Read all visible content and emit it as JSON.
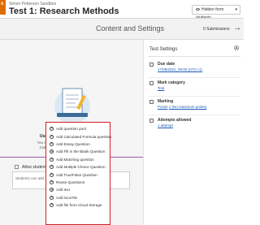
{
  "header": {
    "course_name": "Simon Petterson Sandbox",
    "title": "Test 1: Research Methods",
    "visibility": "Hidden from students",
    "close_glyph": "x"
  },
  "content_bar": {
    "title": "Content and Settings",
    "submissions": "0 Submissions"
  },
  "builder": {
    "title": "Use this space to build your test.",
    "subtitle_1": "You can save your changes along the way.",
    "subtitle_2": "Just close the test when you're finished."
  },
  "allow_students": {
    "label": "Allow student",
    "placeholder": "Students can add"
  },
  "add_menu": {
    "items": [
      "Add question pool",
      "Add Calculated Formula question",
      "Add Essay Question",
      "Add Fill in the Blank Question",
      "Add Matching question",
      "Add Multiple Choice Question",
      "Add True/False Question",
      "Reuse Questions",
      "Add text",
      "Add local file",
      "Add file from Cloud Storage"
    ]
  },
  "settings": {
    "title": "Test Settings",
    "due_date_label": "Due date",
    "due_date_value": "17/08/2021, 09:00 (UTC+1)",
    "mark_category_label": "Mark category",
    "mark_category_value": "Test",
    "marking_label": "Marking",
    "marking_link": "Points",
    "marking_rest": "1 (No maximum points)",
    "attempts_label": "Attempts allowed",
    "attempts_value": "1 attempt"
  }
}
